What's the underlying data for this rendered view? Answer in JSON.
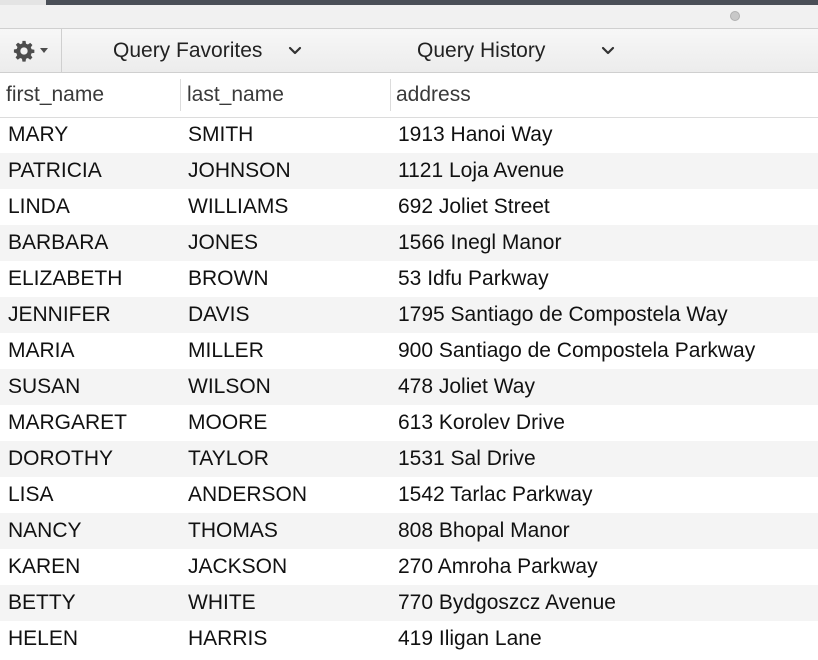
{
  "toolbar": {
    "gear_icon": "gear-icon",
    "query_favorites_label": "Query Favorites",
    "query_history_label": "Query History"
  },
  "columns": [
    "first_name",
    "last_name",
    "address"
  ],
  "rows": [
    [
      "MARY",
      "SMITH",
      "1913 Hanoi Way"
    ],
    [
      "PATRICIA",
      "JOHNSON",
      "1121 Loja Avenue"
    ],
    [
      "LINDA",
      "WILLIAMS",
      "692 Joliet Street"
    ],
    [
      "BARBARA",
      "JONES",
      "1566 Inegl Manor"
    ],
    [
      "ELIZABETH",
      "BROWN",
      "53 Idfu Parkway"
    ],
    [
      "JENNIFER",
      "DAVIS",
      "1795 Santiago de Compostela Way"
    ],
    [
      "MARIA",
      "MILLER",
      "900 Santiago de Compostela Parkway"
    ],
    [
      "SUSAN",
      "WILSON",
      "478 Joliet Way"
    ],
    [
      "MARGARET",
      "MOORE",
      "613 Korolev Drive"
    ],
    [
      "DOROTHY",
      "TAYLOR",
      "1531 Sal Drive"
    ],
    [
      "LISA",
      "ANDERSON",
      "1542 Tarlac Parkway"
    ],
    [
      "NANCY",
      "THOMAS",
      "808 Bhopal Manor"
    ],
    [
      "KAREN",
      "JACKSON",
      "270 Amroha Parkway"
    ],
    [
      "BETTY",
      "WHITE",
      "770 Bydgoszcz Avenue"
    ],
    [
      "HELEN",
      "HARRIS",
      "419 Iligan Lane"
    ]
  ]
}
